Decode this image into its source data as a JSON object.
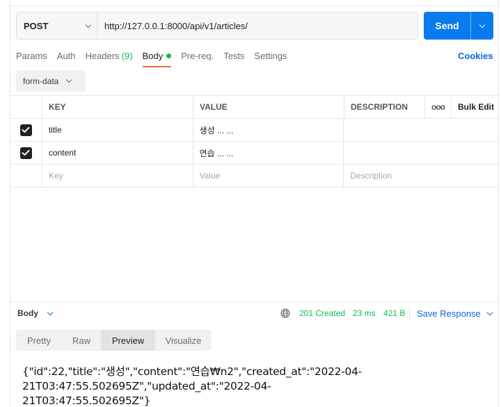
{
  "request": {
    "method": "POST",
    "url": "http://127.0.0.1:8000/api/v1/articles/",
    "send_label": "Send"
  },
  "tabs": {
    "params": "Params",
    "auth": "Auth",
    "headers": "Headers",
    "headers_count": "(9)",
    "body": "Body",
    "prereq": "Pre-req.",
    "tests": "Tests",
    "settings": "Settings",
    "cookies": "Cookies"
  },
  "body_type": "form-data",
  "table": {
    "headers": {
      "key": "KEY",
      "value": "VALUE",
      "description": "DESCRIPTION",
      "more": "ooo",
      "bulk_edit": "Bulk Edit"
    },
    "rows": [
      {
        "checked": true,
        "key": "title",
        "value": "생성 ... ..."
      },
      {
        "checked": true,
        "key": "content",
        "value": "연습 ... ..."
      }
    ],
    "placeholders": {
      "key": "Key",
      "value": "Value",
      "description": "Description"
    }
  },
  "response": {
    "label": "Body",
    "status": "201 Created",
    "time": "23 ms",
    "size": "421 B",
    "save_label": "Save Response",
    "views": [
      "Pretty",
      "Raw",
      "Preview",
      "Visualize"
    ],
    "active_view": "Preview",
    "content": "{\"id\":22,\"title\":\"생성\",\"content\":\"연습₩n2\",\"created_at\":\"2022-04-21T03:47:55.502695Z\",\"updated_at\":\"2022-04-21T03:47:55.502695Z\"}"
  },
  "colors": {
    "accent": "#097bed",
    "active_tab": "#ff6c37",
    "success": "#0cbb52",
    "link": "#0b68d6"
  }
}
